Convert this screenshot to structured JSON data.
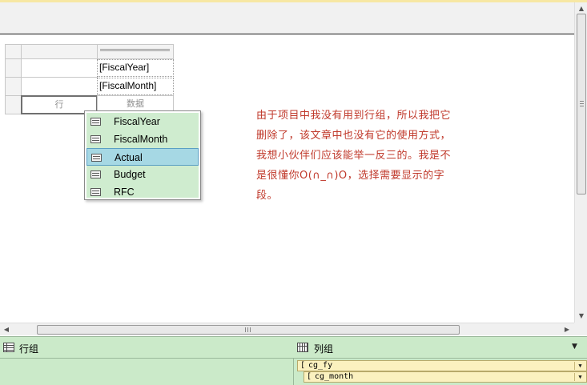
{
  "tablix": {
    "col_header_field_1": "[FiscalYear]",
    "col_header_field_2": "[FiscalMonth]",
    "row_cell_label": "行",
    "data_cell_label": "数据"
  },
  "dropdown": {
    "items": [
      {
        "label": "FiscalYear",
        "selected": false
      },
      {
        "label": "FiscalMonth",
        "selected": false
      },
      {
        "label": "Actual",
        "selected": true
      },
      {
        "label": "Budget",
        "selected": false
      },
      {
        "label": "RFC",
        "selected": false
      }
    ]
  },
  "note": {
    "lines": [
      "由于项目中我没有用到行组，所以我把它",
      "删除了，该文章中也没有它的使用方式，",
      "我想小伙伴们应该能举一反三的。我是不",
      "是很懂你O(∩_∩)O，选择需要显示的字",
      "段。"
    ],
    "color": "#c0392b"
  },
  "grouping": {
    "row_groups_title": "行组",
    "column_groups_title": "列组",
    "column_groups": [
      "cg_fy",
      "cg_month"
    ],
    "panel_color": "#cbeac9"
  },
  "icons": {
    "dropdown_item": "field-icon",
    "row_groups": "row-groups-icon",
    "column_groups": "column-groups-icon"
  }
}
